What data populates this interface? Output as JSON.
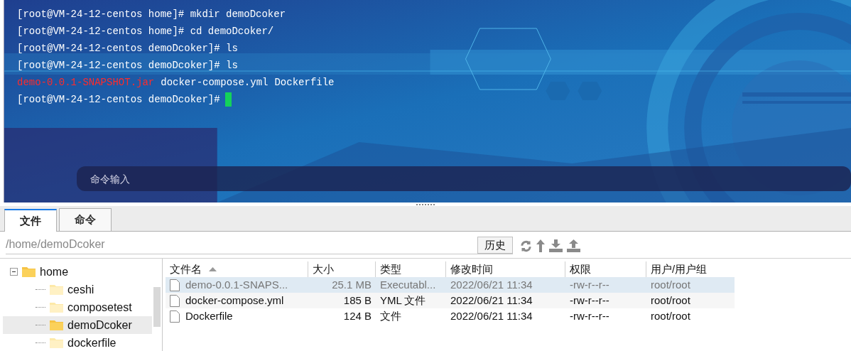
{
  "terminal": {
    "lines": [
      {
        "segments": [
          {
            "text": "[root@VM-24-12-centos home]# mkdir demoDcoker",
            "color": "#ffffff"
          }
        ],
        "cursor": false
      },
      {
        "segments": [
          {
            "text": "[root@VM-24-12-centos home]# cd demoDcoker/",
            "color": "#ffffff"
          }
        ],
        "cursor": false
      },
      {
        "segments": [
          {
            "text": "[root@VM-24-12-centos demoDcoker]# ls",
            "color": "#ffffff"
          }
        ],
        "cursor": false
      },
      {
        "segments": [
          {
            "text": "[root@VM-24-12-centos demoDcoker]# ls",
            "color": "#ffffff"
          }
        ],
        "cursor": false
      },
      {
        "segments": [
          {
            "text": "demo-0.0.1-SNAPSHOT.jar",
            "color": "#ff2b2b"
          },
          {
            "text": "docker-compose.yml",
            "color": "#ffffff"
          },
          {
            "text": "Dockerfile",
            "color": "#ffffff"
          }
        ],
        "cursor": false
      },
      {
        "segments": [
          {
            "text": "[root@VM-24-12-centos demoDcoker]#",
            "color": "#ffffff"
          }
        ],
        "cursor": true
      }
    ],
    "command_input": {
      "placeholder": "命令输入"
    }
  },
  "tabs": [
    {
      "label": "文件",
      "selected": true
    },
    {
      "label": "命令",
      "selected": false
    }
  ],
  "path_field": {
    "value": "/home/demoDcoker"
  },
  "history_button": "历史",
  "tree": [
    {
      "label": "home",
      "expanded": true,
      "selected": false,
      "children": [
        {
          "label": "ceshi",
          "selected": false
        },
        {
          "label": "composetest",
          "selected": false
        },
        {
          "label": "demoDcoker",
          "selected": true
        },
        {
          "label": "dockerfile",
          "selected": false
        }
      ]
    }
  ],
  "table": {
    "columns": [
      {
        "label": "文件名",
        "sorted": true
      },
      {
        "label": "大小",
        "sorted": false
      },
      {
        "label": "类型",
        "sorted": false
      },
      {
        "label": "修改时间",
        "sorted": false
      },
      {
        "label": "权限",
        "sorted": false
      },
      {
        "label": "用户/用户组",
        "sorted": false
      }
    ],
    "rows": [
      {
        "cells": [
          "demo-0.0.1-SNAPS...",
          "25.1 MB",
          "Executabl...",
          "2022/06/21 11:34",
          "-rw-r--r--",
          "root/root"
        ],
        "selected": true
      },
      {
        "cells": [
          "docker-compose.yml",
          "185 B",
          "YML 文件",
          "2022/06/21 11:34",
          "-rw-r--r--",
          "root/root"
        ],
        "selected": false
      },
      {
        "cells": [
          "Dockerfile",
          "124 B",
          "文件",
          "2022/06/21 11:34",
          "-rw-r--r--",
          "root/root"
        ],
        "selected": false
      }
    ]
  }
}
